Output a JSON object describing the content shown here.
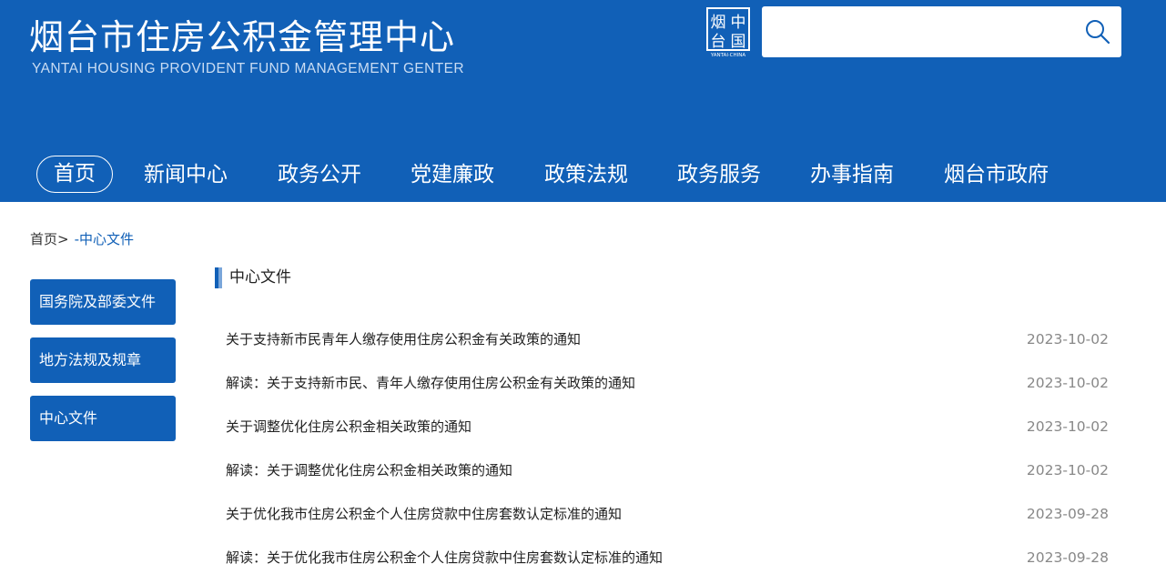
{
  "header": {
    "title": "烟台市住房公积金管理中心",
    "subtitle": "YANTAI HOUSING PROVIDENT FUND MANAGEMENT GENTER",
    "logo_text": "烟台中国",
    "logo_caption": "YANTAI·CHINA",
    "search_placeholder": "",
    "search_icon": "search-icon"
  },
  "nav": {
    "items": [
      {
        "label": "首页"
      },
      {
        "label": "新闻中心"
      },
      {
        "label": "政务公开"
      },
      {
        "label": "党建廉政"
      },
      {
        "label": "政策法规"
      },
      {
        "label": "政务服务"
      },
      {
        "label": "办事指南"
      },
      {
        "label": "烟台市政府"
      }
    ]
  },
  "breadcrumb": {
    "home": "首页",
    "separator": ">",
    "current": "-中心文件"
  },
  "sidebar": {
    "items": [
      {
        "label": "国务院及部委文件"
      },
      {
        "label": "地方法规及规章"
      },
      {
        "label": "中心文件"
      }
    ]
  },
  "section": {
    "title": "中心文件"
  },
  "list": {
    "items": [
      {
        "title": "关于支持新市民青年人缴存使用住房公积金有关政策的通知",
        "date": "2023-10-02"
      },
      {
        "title": "解读：关于支持新市民、青年人缴存使用住房公积金有关政策的通知",
        "date": "2023-10-02"
      },
      {
        "title": "关于调整优化住房公积金相关政策的通知",
        "date": "2023-10-02"
      },
      {
        "title": "解读：关于调整优化住房公积金相关政策的通知",
        "date": "2023-10-02"
      },
      {
        "title": "关于优化我市住房公积金个人住房贷款中住房套数认定标准的通知",
        "date": "2023-09-28"
      },
      {
        "title": "解读：关于优化我市住房公积金个人住房贷款中住房套数认定标准的通知",
        "date": "2023-09-28"
      }
    ]
  },
  "colors": {
    "brand": "#1160b7",
    "date": "#888888"
  }
}
